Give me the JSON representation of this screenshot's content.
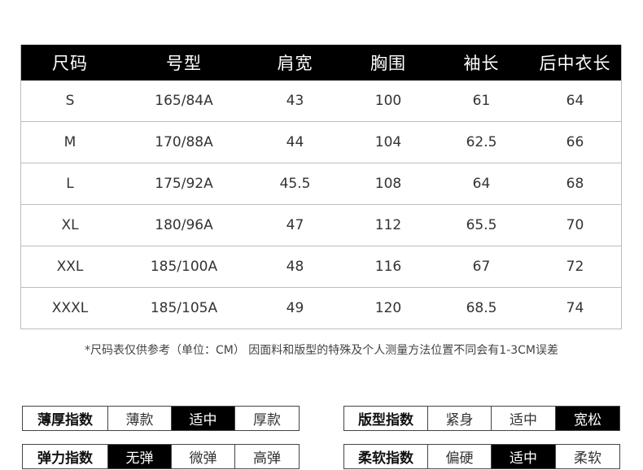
{
  "table": {
    "headers": [
      "尺码",
      "号型",
      "肩宽",
      "胸围",
      "袖长",
      "后中衣长"
    ],
    "rows": [
      [
        "S",
        "165/84A",
        "43",
        "100",
        "61",
        "64"
      ],
      [
        "M",
        "170/88A",
        "44",
        "104",
        "62.5",
        "66"
      ],
      [
        "L",
        "175/92A",
        "45.5",
        "108",
        "64",
        "68"
      ],
      [
        "XL",
        "180/96A",
        "47",
        "112",
        "65.5",
        "70"
      ],
      [
        "XXL",
        "185/100A",
        "48",
        "116",
        "67",
        "72"
      ],
      [
        "XXXL",
        "185/105A",
        "49",
        "120",
        "68.5",
        "74"
      ]
    ]
  },
  "note": "*尺码表仅供参考（单位：CM） 因面料和版型的特殊及个人测量方法位置不同会有1-3CM误差",
  "indices": [
    {
      "label": "薄厚指数",
      "options": [
        "薄款",
        "适中",
        "厚款"
      ],
      "selected": 1
    },
    {
      "label": "版型指数",
      "options": [
        "紧身",
        "适中",
        "宽松"
      ],
      "selected": 2
    },
    {
      "label": "弹力指数",
      "options": [
        "无弹",
        "微弹",
        "高弹"
      ],
      "selected": 0
    },
    {
      "label": "柔软指数",
      "options": [
        "偏硬",
        "适中",
        "柔软"
      ],
      "selected": 1
    }
  ],
  "colors": {
    "header_bg": "#000000",
    "header_text": "#ffffff",
    "grid_line": "#bdbdbd",
    "selected_bg": "#000000"
  }
}
